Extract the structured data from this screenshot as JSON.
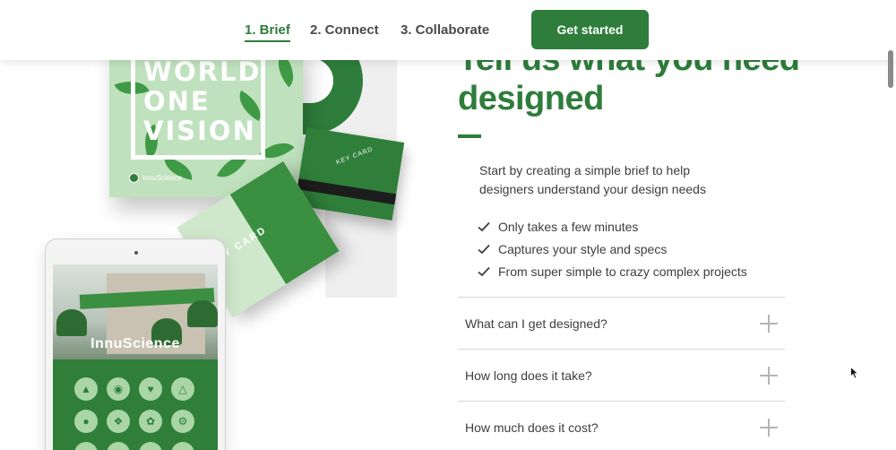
{
  "nav": {
    "steps": [
      {
        "label": "1. Brief",
        "active": true
      },
      {
        "label": "2. Connect",
        "active": false
      },
      {
        "label": "3. Collaborate",
        "active": false
      }
    ],
    "cta_label": "Get started"
  },
  "hero": {
    "title_line1": "Tell us what you need",
    "title_line2": "designed",
    "intro_line1": "Start by creating a simple brief to help",
    "intro_line2": "designers understand your design needs"
  },
  "checklist": [
    "Only takes a few minutes",
    "Captures your style and specs",
    "From super simple to crazy complex projects"
  ],
  "faq": [
    "What can I get designed?",
    "How long does it take?",
    "How much does it cost?"
  ],
  "artwork": {
    "poster_line1": "WORLD",
    "poster_line2": "ONE",
    "poster_line3": "VISION",
    "poster_brand": "InnuScience",
    "keycard_label": "KEY CARD",
    "folder_label": "KEY CARD",
    "tablet_brand": "InnuScience"
  },
  "colors": {
    "brand_green": "#2e7d3b",
    "light_green": "#bfe1bd",
    "text": "#3d3d3d"
  }
}
